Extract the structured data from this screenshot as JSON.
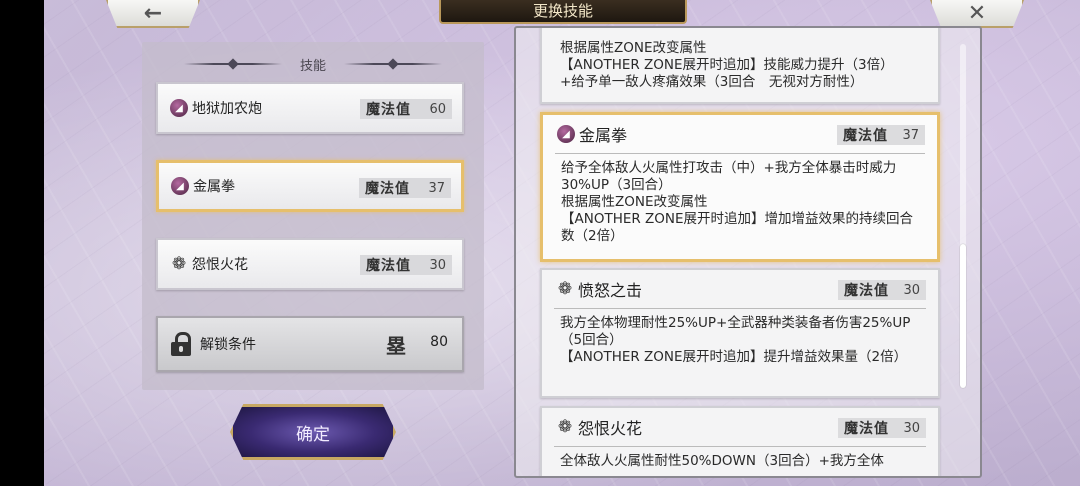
{
  "header": {
    "title": "更换技能",
    "back_icon": "←",
    "close_icon": "✕"
  },
  "left_panel": {
    "title": "技能",
    "slots": [
      {
        "name": "地狱加农炮",
        "cost_label": "魔法值",
        "cost": "60",
        "icon": "dark-skill-icon"
      },
      {
        "name": "金属拳",
        "cost_label": "魔法值",
        "cost": "37",
        "icon": "dark-skill-icon"
      },
      {
        "name": "怨恨火花",
        "cost_label": "魔法值",
        "cost": "30",
        "icon": "flower-skill-icon"
      }
    ],
    "locked_slot": {
      "name": "解锁条件",
      "glyph": "塁",
      "value": "80"
    }
  },
  "confirm_label": "确定",
  "skill_list": {
    "cards": [
      {
        "name": "",
        "cost_label": "",
        "cost": "",
        "description": "根据属性ZONE改变属性\n【ANOTHER ZONE展开时追加】技能威力提升（3倍）\n+给予单一敌人疼痛效果（3回合　无视对方耐性）"
      },
      {
        "name": "金属拳",
        "cost_label": "魔法值",
        "cost": "37",
        "icon": "dark-skill-icon",
        "selected": true,
        "description": "给予全体敌人火属性打攻击（中）+我方全体暴击时威力30%UP（3回合）\n根据属性ZONE改变属性\n【ANOTHER ZONE展开时追加】增加增益效果的持续回合数（2倍）"
      },
      {
        "name": "愤怒之击",
        "cost_label": "魔法值",
        "cost": "30",
        "icon": "flower-skill-icon",
        "description": "我方全体物理耐性25%UP+全武器种类装备者伤害25%UP（5回合）\n【ANOTHER ZONE展开时追加】提升增益效果量（2倍）"
      },
      {
        "name": "怨恨火花",
        "cost_label": "魔法值",
        "cost": "30",
        "icon": "flower-skill-icon",
        "description": "全体敌人火属性耐性50%DOWN（3回合）+我方全体"
      }
    ]
  }
}
